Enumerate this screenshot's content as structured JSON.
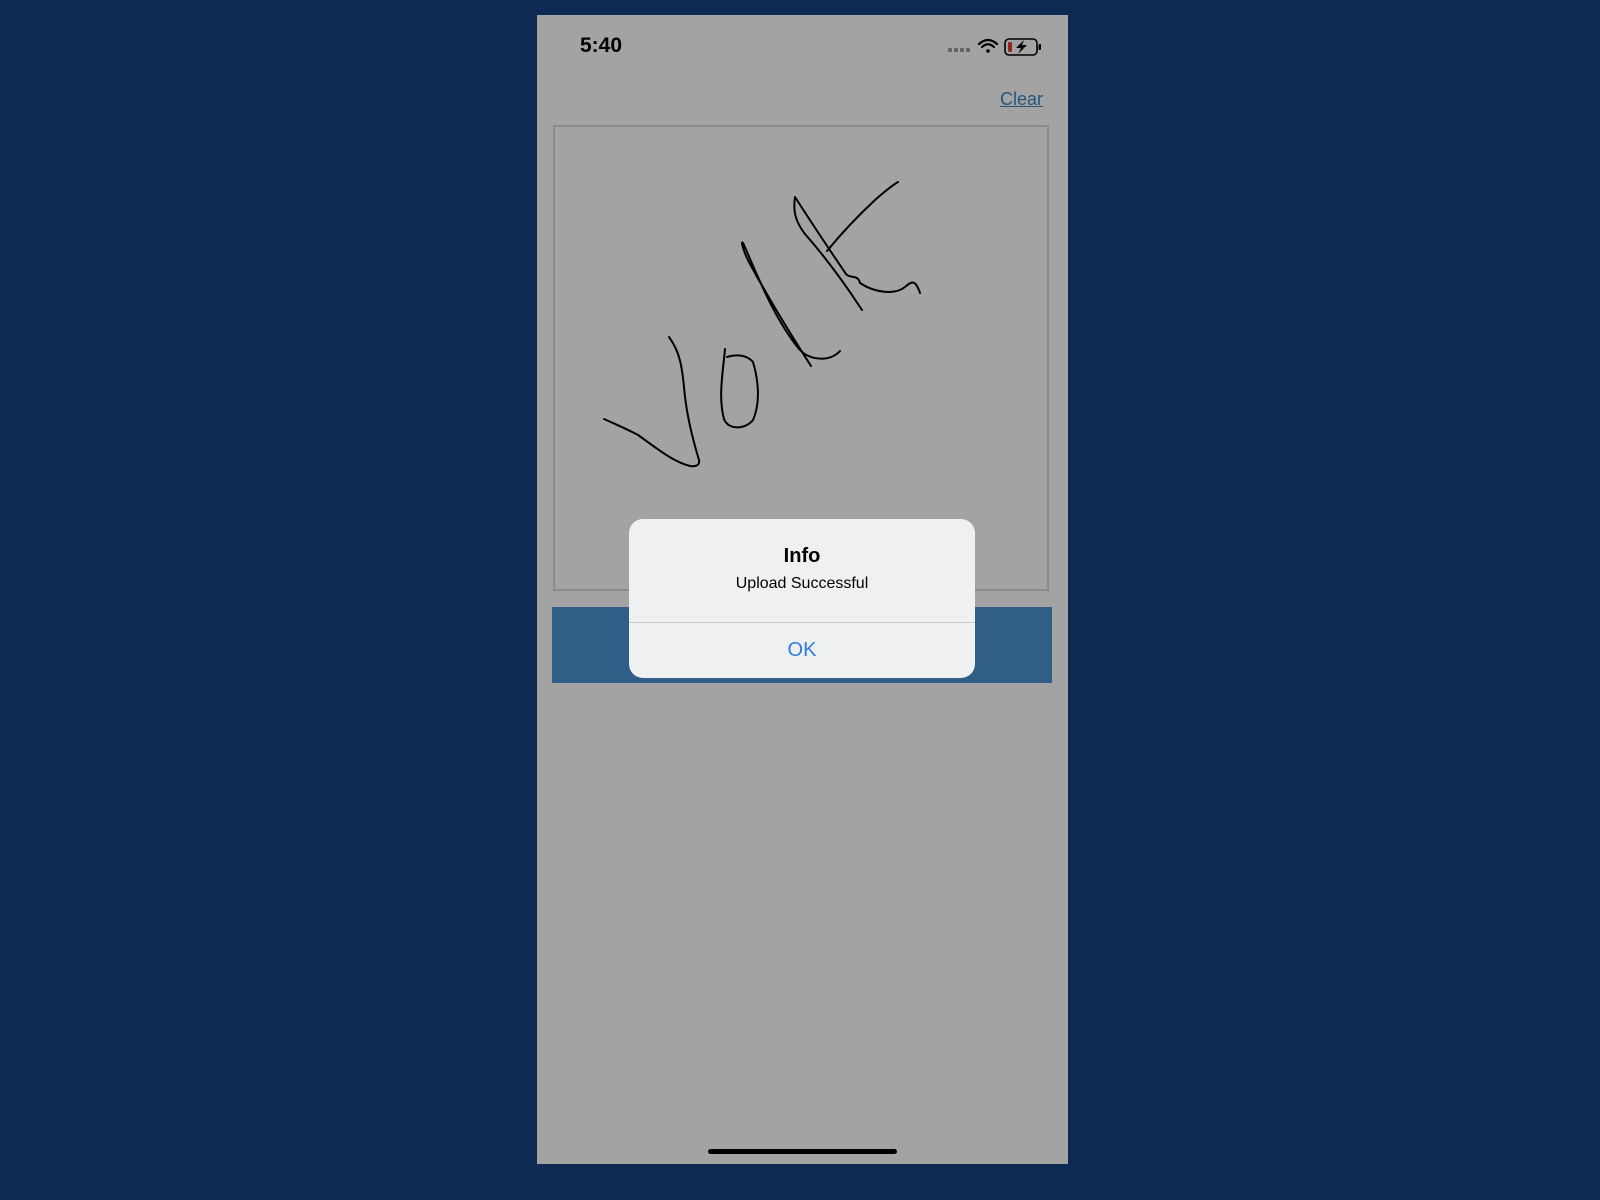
{
  "status_bar": {
    "time": "5:40",
    "icons": [
      "signal-icon",
      "wifi-icon",
      "battery-charging-icon"
    ]
  },
  "toolbar": {
    "clear_label": "Clear"
  },
  "alert": {
    "title": "Info",
    "message": "Upload Successful",
    "ok_label": "OK"
  },
  "colors": {
    "page_background": "#0e2a52",
    "accent": "#4d94d4",
    "link": "#3a86c4",
    "alert_button": "#2f7de2",
    "battery_low": "#e53935"
  }
}
